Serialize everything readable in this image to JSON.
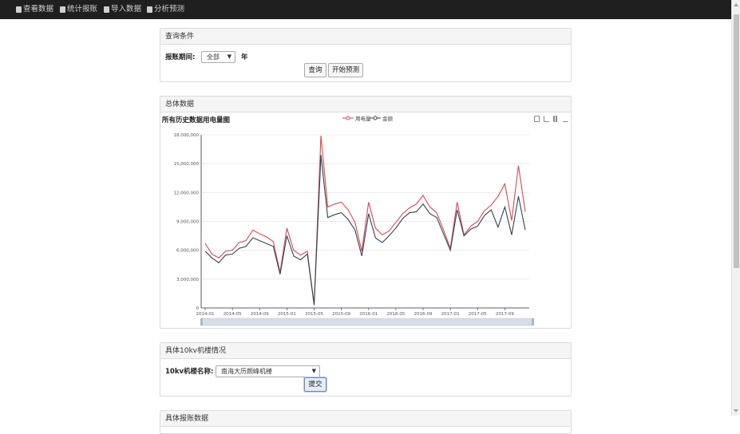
{
  "nav": {
    "items": [
      {
        "label": "查看数据",
        "icon": "lock-icon"
      },
      {
        "label": "统计报账",
        "icon": "document-icon"
      },
      {
        "label": "导入数据",
        "icon": "document-icon"
      },
      {
        "label": "分析预测",
        "icon": "document-icon"
      }
    ]
  },
  "query_panel": {
    "title": "查询条件",
    "period_label": "报账期间:",
    "period_value": "全部",
    "year_suffix": "年",
    "query_button": "查询",
    "predict_button": "开始预测"
  },
  "overview_panel": {
    "title": "总体数据"
  },
  "building_panel": {
    "title": "具体10kv机楼情况",
    "name_label": "10kv机楼名称:",
    "name_value": "南海大历颜峰机楼",
    "submit_button": "提交"
  },
  "next_panel": {
    "title": "具体报账数据"
  },
  "colors": {
    "series1": "#d9484f",
    "series2": "#2f4554",
    "navbar": "#1f1f1f"
  },
  "chart_data": {
    "type": "line",
    "title": "所有历史数据用电量图",
    "legend": [
      "用电量",
      "金额"
    ],
    "legend_position": "top-center",
    "ylim": [
      0,
      18000000
    ],
    "yticks": [
      "0",
      "3,000,000",
      "6,000,000",
      "9,000,000",
      "12,000,000",
      "15,000,000",
      "18,000,000"
    ],
    "xticks": [
      "2014-01",
      "2014-05",
      "2014-09",
      "2015-01",
      "2015-05",
      "2015-09",
      "2016-01",
      "2016-05",
      "2016-09",
      "2017-01",
      "2017-05",
      "2017-09"
    ],
    "grid": true,
    "x": [
      "2014-01",
      "2014-02",
      "2014-03",
      "2014-04",
      "2014-05",
      "2014-06",
      "2014-07",
      "2014-08",
      "2014-09",
      "2014-10",
      "2014-11",
      "2014-12",
      "2015-01",
      "2015-02",
      "2015-03",
      "2015-04",
      "2015-05",
      "2015-06",
      "2015-07",
      "2015-08",
      "2015-09",
      "2015-10",
      "2015-11",
      "2015-12",
      "2016-01",
      "2016-02",
      "2016-03",
      "2016-04",
      "2016-05",
      "2016-06",
      "2016-07",
      "2016-08",
      "2016-09",
      "2016-10",
      "2016-11",
      "2016-12",
      "2017-01",
      "2017-02",
      "2017-03",
      "2017-04",
      "2017-05",
      "2017-06",
      "2017-07",
      "2017-08",
      "2017-09",
      "2017-10",
      "2017-11",
      "2017-12"
    ],
    "series": [
      {
        "name": "用电量",
        "values": [
          6700000,
          5600000,
          5200000,
          5900000,
          6000000,
          6800000,
          7000000,
          8100000,
          7700000,
          7400000,
          6900000,
          3700000,
          8300000,
          6000000,
          5500000,
          5900000,
          400000,
          17900000,
          10500000,
          10800000,
          11000000,
          10200000,
          8900000,
          5900000,
          11000000,
          8300000,
          7600000,
          8000000,
          8900000,
          9800000,
          10400000,
          10800000,
          11700000,
          10500000,
          9900000,
          8100000,
          6200000,
          11000000,
          7600000,
          8500000,
          9000000,
          10100000,
          10700000,
          11600000,
          12900000,
          9100000,
          14800000,
          10000000
        ]
      },
      {
        "name": "金额",
        "values": [
          5900000,
          5200000,
          4700000,
          5500000,
          5600000,
          6200000,
          6400000,
          7300000,
          7000000,
          6700000,
          6400000,
          3500000,
          7500000,
          5400000,
          5000000,
          5600000,
          300000,
          15900000,
          9400000,
          9700000,
          9900000,
          9200000,
          8100000,
          5400000,
          9800000,
          7300000,
          6800000,
          7500000,
          8300000,
          9300000,
          9900000,
          10000000,
          10800000,
          9800000,
          9400000,
          7700000,
          6000000,
          10200000,
          7500000,
          8200000,
          8500000,
          9600000,
          10200000,
          8400000,
          10500000,
          7600000,
          11600000,
          8100000
        ]
      }
    ]
  }
}
